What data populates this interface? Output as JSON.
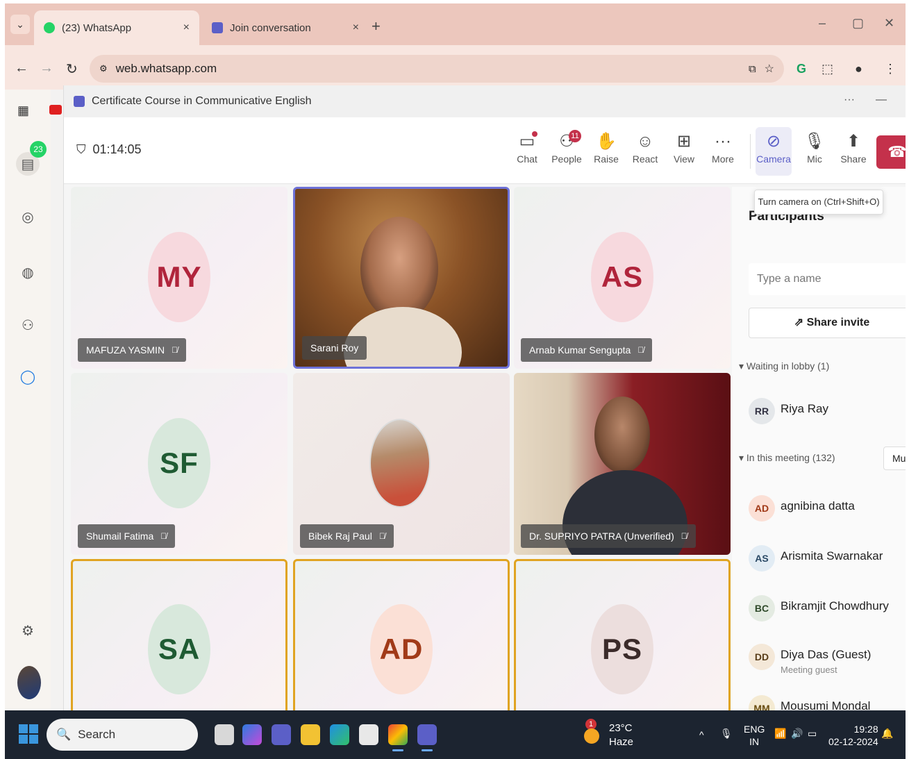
{
  "browser": {
    "tabs": [
      {
        "title": "(23) WhatsApp",
        "close": "×"
      },
      {
        "title": "Join conversation",
        "close": "×"
      }
    ],
    "new_tab": "+",
    "url": "web.whatsapp.com",
    "window_controls": {
      "minimize": "–",
      "restore": "▢",
      "close": "✕"
    }
  },
  "whatsapp": {
    "unread_badge": "23"
  },
  "teams": {
    "window_title": "Certificate Course in Communicative English",
    "timer": "01:14:05",
    "controls": {
      "chat": "Chat",
      "people": "People",
      "people_count": "11",
      "raise": "Raise",
      "react": "React",
      "view": "View",
      "more": "More",
      "camera": "Camera",
      "mic": "Mic",
      "share": "Share"
    },
    "tooltip": "Turn camera on (Ctrl+Shift+O)",
    "tiles": [
      {
        "initials": "MY",
        "name": "MAFUZA YASMIN",
        "avatar_bg": "#f7d9de",
        "avatar_fg": "#b0243b",
        "kind": "avatar",
        "border": "none"
      },
      {
        "initials": "",
        "name": "Sarani Roy",
        "kind": "video-sr",
        "border": "speaker"
      },
      {
        "initials": "AS",
        "name": "Arnab Kumar Sengupta",
        "avatar_bg": "#f7d9de",
        "avatar_fg": "#b0243b",
        "kind": "avatar",
        "border": "none"
      },
      {
        "initials": "SF",
        "name": "Shumail Fatima",
        "avatar_bg": "#d8e8dc",
        "avatar_fg": "#1f5b33",
        "kind": "avatar",
        "border": "none"
      },
      {
        "initials": "",
        "name": "Bibek Raj Paul",
        "kind": "video-br",
        "border": "none"
      },
      {
        "initials": "",
        "name": "Dr. SUPRIYO PATRA (Unverified)",
        "kind": "video-sp",
        "border": "none"
      },
      {
        "initials": "SA",
        "name": "",
        "avatar_bg": "#d8e8dc",
        "avatar_fg": "#1f5b33",
        "kind": "avatar",
        "border": "gold"
      },
      {
        "initials": "AD",
        "name": "",
        "avatar_bg": "#fbe0d6",
        "avatar_fg": "#a13a18",
        "kind": "avatar",
        "border": "gold"
      },
      {
        "initials": "PS",
        "name": "",
        "avatar_bg": "#ecdedd",
        "avatar_fg": "#3b2b2a",
        "kind": "avatar",
        "border": "gold"
      }
    ],
    "participants": {
      "title": "Participants",
      "search_placeholder": "Type a name",
      "share_invite": "Share invite",
      "lobby_header": "Waiting in lobby (1)",
      "lobby": [
        {
          "initials": "RR",
          "name": "Riya Ray"
        }
      ],
      "meeting_header": "In this meeting (132)",
      "mute_all": "Mut",
      "members": [
        {
          "initials": "AD",
          "name": "agnibina datta",
          "sub": "",
          "bg": "#fbe0d6",
          "fg": "#a13a18"
        },
        {
          "initials": "AS",
          "name": "Arismita Swarnakar",
          "sub": "",
          "bg": "#e2ecf4",
          "fg": "#2b4a66"
        },
        {
          "initials": "BC",
          "name": "Bikramjit Chowdhury",
          "sub": "",
          "bg": "#e4ebe2",
          "fg": "#2f4a2a"
        },
        {
          "initials": "DD",
          "name": "Diya Das (Guest)",
          "sub": "Meeting guest",
          "bg": "#f4e8d8",
          "fg": "#5a3e1a"
        },
        {
          "initials": "MM",
          "name": "Mousumi Mondal",
          "sub": "",
          "bg": "#f4ead2",
          "fg": "#6a4e10"
        }
      ]
    }
  },
  "taskbar": {
    "search_placeholder": "Search",
    "weather_temp": "23°C",
    "weather_desc": "Haze",
    "weather_badge": "1",
    "lang_1": "ENG",
    "lang_2": "IN",
    "time": "19:28",
    "date": "02-12-2024"
  }
}
